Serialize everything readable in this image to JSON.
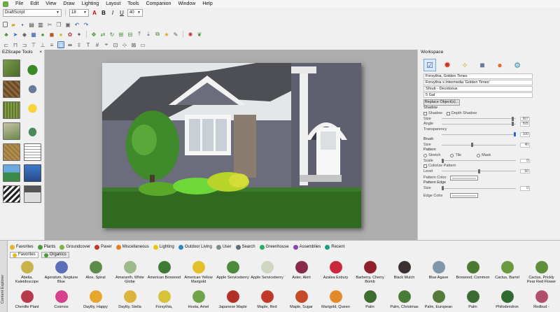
{
  "menu": [
    "File",
    "Edit",
    "View",
    "Draw",
    "Lighting",
    "Layout",
    "Tools",
    "Companion",
    "Window",
    "Help"
  ],
  "toolbar": {
    "font_name": "DraftScript",
    "font_size": "18",
    "zoom_value": "40"
  },
  "left_panel": {
    "title": "EZScape Tools",
    "close_glyph": "×"
  },
  "workspace": {
    "title": "Workspace",
    "plant_name": "Forsythia, Golden Times",
    "botanical_name": "Forsythia x intermedia 'Golden Times'",
    "category": "Shrub - Deciduous",
    "size": "5 Gal",
    "replace_button": "Replace Object(s)...",
    "shadow_label": "Shadow",
    "shadow_checkbox": "Shadow",
    "depth_shadow_checkbox": "Depth Shadow",
    "size_label": "Size",
    "size_value": "507",
    "angle_label": "Angle",
    "angle_value": "505",
    "transparency_label": "Transparency",
    "transparency_value": "100",
    "brush_label": "Brush",
    "brush_size_label": "Size",
    "brush_size_value": "40",
    "pattern_label": "Pattern",
    "pattern_options": [
      "Stretch",
      "Tile",
      "Mask"
    ],
    "scale_label": "Scale",
    "scale_value": "0",
    "colorize_label": "Colorize Pattern",
    "level_label": "Level",
    "level_value": "50",
    "pattern_color_label": "Pattern Color",
    "pattern_edge_label": "Pattern Edge",
    "edge_size_label": "Size",
    "edge_size_value": "0",
    "edge_color_label": "Edge Color"
  },
  "explorer": {
    "side_label": "Content Explorer",
    "categories": [
      {
        "label": "Favorites",
        "color": "#e8b32a"
      },
      {
        "label": "Plants",
        "color": "#4a9c3a"
      },
      {
        "label": "Groundcover",
        "color": "#7cb342"
      },
      {
        "label": "Paver",
        "color": "#c0392b"
      },
      {
        "label": "Miscellaneous",
        "color": "#e67e22"
      },
      {
        "label": "Lighting",
        "color": "#f1c40f"
      },
      {
        "label": "Outdoor Living",
        "color": "#2e86c1"
      },
      {
        "label": "User",
        "color": "#7f8c8d"
      },
      {
        "label": "Search",
        "color": "#5d6d7e"
      },
      {
        "label": "Greenhouse",
        "color": "#27ae60"
      },
      {
        "label": "Assemblies",
        "color": "#8e44ad"
      },
      {
        "label": "Recent",
        "color": "#16a085"
      }
    ],
    "sub_tabs": [
      "Favorites",
      "Organics"
    ],
    "plants": [
      {
        "name": "Abelia, Kaleidoscope",
        "color": "#c9b24a"
      },
      {
        "name": "Ageratum, Neptune Blue",
        "color": "#5b6fb8"
      },
      {
        "name": "Aloe, Spiral",
        "color": "#5c8c4a"
      },
      {
        "name": "Amaranth, White Globe",
        "color": "#9bb98a"
      },
      {
        "name": "American Boxwood",
        "color": "#3f7a35"
      },
      {
        "name": "American Yellow Marigold",
        "color": "#e3c02b"
      },
      {
        "name": "Apple Serviceberry",
        "color": "#4c8a3c"
      },
      {
        "name": "Apple Serviceberry",
        "color": "#cfd7c0"
      },
      {
        "name": "Aster, Alert",
        "color": "#8a2a4a"
      },
      {
        "name": "Azalea Exbury",
        "color": "#c8283a"
      },
      {
        "name": "Barberry, Cherry Bomb",
        "color": "#8e1f2c"
      },
      {
        "name": "Black Mulch",
        "color": "#3b3030"
      },
      {
        "name": "Blue Agave",
        "color": "#7f97a8"
      },
      {
        "name": "Boxwood, Common",
        "color": "#4a7a30"
      },
      {
        "name": "Cactus, Barrel",
        "color": "#6a9a40"
      },
      {
        "name": "Cactus, Prickly Pear Red Flower",
        "color": "#5f8f3a"
      },
      {
        "name": "Chenille Plant",
        "color": "#b83a4a"
      },
      {
        "name": "Cosmos",
        "color": "#d4408a"
      },
      {
        "name": "Daylily, Happy",
        "color": "#e6a62b"
      },
      {
        "name": "Daylily, Stella",
        "color": "#dbb43a"
      },
      {
        "name": "Forsythia,",
        "color": "#d8c23a"
      },
      {
        "name": "Hosta, Amel",
        "color": "#6fa34a"
      },
      {
        "name": "Japanese Maple",
        "color": "#b3302a"
      },
      {
        "name": "Maple, Red",
        "color": "#c03a2a"
      },
      {
        "name": "Maple, Sugar",
        "color": "#c44a2a"
      },
      {
        "name": "Marigold, Queen",
        "color": "#e08a2a"
      },
      {
        "name": "Palm",
        "color": "#3f6a30"
      },
      {
        "name": "Palm, Christmas",
        "color": "#4a7a38"
      },
      {
        "name": "Palm, European",
        "color": "#557a3a"
      },
      {
        "name": "Palm",
        "color": "#3c6a30"
      },
      {
        "name": "Philodendron",
        "color": "#2e6a2e"
      },
      {
        "name": "Redbud -",
        "color": "#b0506a"
      }
    ]
  }
}
